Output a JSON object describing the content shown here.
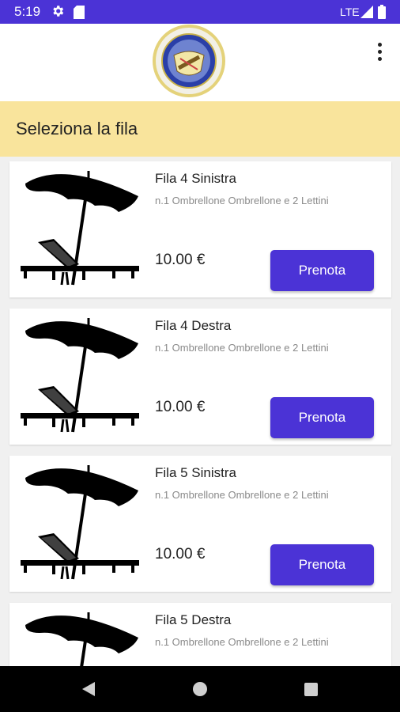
{
  "status_bar": {
    "time": "5:19",
    "network": "LTE",
    "icons": [
      "settings-gear-icon",
      "sd-card-icon",
      "signal-icon",
      "battery-icon"
    ]
  },
  "app_bar": {
    "logo": "circular-crest-logo",
    "menu_icon": "more-vert-icon"
  },
  "section": {
    "title": "Seleziona la fila"
  },
  "rows": [
    {
      "title": "Fila 4 Sinistra",
      "description": "n.1 Ombrellone Ombrellone e 2 Lettini",
      "price": "10.00 €",
      "button": "Prenota"
    },
    {
      "title": "Fila 4 Destra",
      "description": "n.1 Ombrellone Ombrellone e 2 Lettini",
      "price": "10.00 €",
      "button": "Prenota"
    },
    {
      "title": "Fila 5 Sinistra",
      "description": "n.1 Ombrellone Ombrellone e 2 Lettini",
      "price": "10.00 €",
      "button": "Prenota"
    },
    {
      "title": "Fila 5 Destra",
      "description": "n.1 Ombrellone Ombrellone e 2 Lettini",
      "price": "",
      "button": ""
    }
  ],
  "colors": {
    "primary": "#4b33d6",
    "header_bg": "#f9e49c",
    "card_bg": "#ffffff",
    "nav_bar": "#000000"
  },
  "nav_bar": {
    "icons": [
      "back-icon",
      "home-icon",
      "recents-icon"
    ]
  }
}
